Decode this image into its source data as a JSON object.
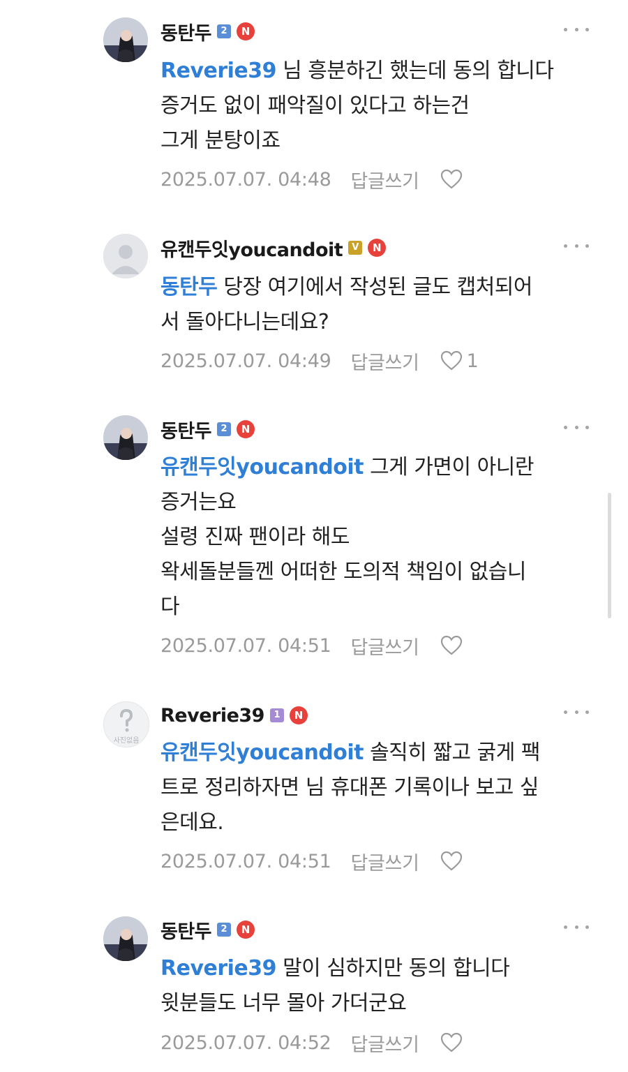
{
  "colors": {
    "mention": "#2f7fd6",
    "n_badge": "#e8413b",
    "level_blue": "#5a8fd8",
    "level_gold": "#c9a227",
    "level_purple": "#a58bd6",
    "meta_text": "#9a9a9a"
  },
  "comments": [
    {
      "author": "동탄두",
      "level_badge": "2",
      "new_badge": "N",
      "mention": "Reverie39",
      "text_first": " 님 흥분하긴 했는데 동의 합니다",
      "text_rest": "증거도 없이 패악질이 있다고 하는건\n그게 분탕이죠",
      "timestamp": "2025.07.07. 04:48",
      "reply_label": "답글쓰기",
      "like_count": ""
    },
    {
      "author": "유캔두잇youcandoit",
      "level_badge": "V",
      "new_badge": "N",
      "mention": "동탄두",
      "text_first": " 당장 여기에서 작성된 글도 캡처되어",
      "text_rest": "서 돌아다니는데요?",
      "timestamp": "2025.07.07. 04:49",
      "reply_label": "답글쓰기",
      "like_count": "1"
    },
    {
      "author": "동탄두",
      "level_badge": "2",
      "new_badge": "N",
      "mention": "유캔두잇youcandoit",
      "text_first": " 그게 가면이 아니란",
      "text_rest": "증거는요\n설령 진짜 팬이라 해도\n왁세돌분들껜 어떠한 도의적 책임이 없습니\n다",
      "timestamp": "2025.07.07. 04:51",
      "reply_label": "답글쓰기",
      "like_count": ""
    },
    {
      "author": "Reverie39",
      "level_badge": "1",
      "new_badge": "N",
      "avatar_caption": "사진없음",
      "mention": "유캔두잇youcandoit",
      "text_first": " 솔직히 짧고 굵게 팩",
      "text_rest": "트로 정리하자면 님 휴대폰 기록이나 보고 싶\n은데요.",
      "timestamp": "2025.07.07. 04:51",
      "reply_label": "답글쓰기",
      "like_count": ""
    },
    {
      "author": "동탄두",
      "level_badge": "2",
      "new_badge": "N",
      "mention": "Reverie39",
      "text_first": " 말이 심하지만 동의 합니다",
      "text_rest": "윗분들도 너무 몰아 가더군요",
      "timestamp": "2025.07.07. 04:52",
      "reply_label": "답글쓰기",
      "like_count": ""
    }
  ]
}
